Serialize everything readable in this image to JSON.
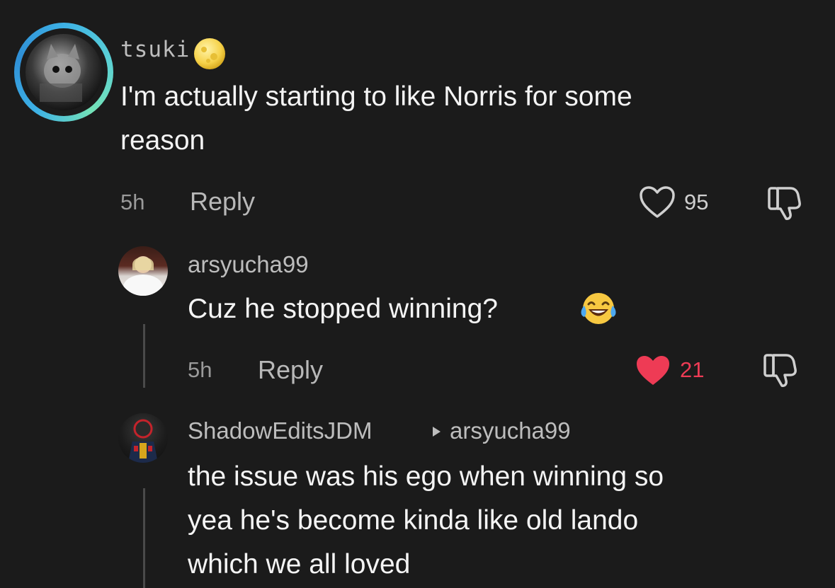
{
  "comments": [
    {
      "username": "tsuki",
      "text_line1": "I'm actually starting to like Norris for some",
      "text_line2": "reason",
      "time": "5h",
      "reply_label": "Reply",
      "likes": "95",
      "liked": false
    },
    {
      "username": "arsyucha99",
      "text": "Cuz he stopped winning?",
      "time": "5h",
      "reply_label": "Reply",
      "likes": "21",
      "liked": true
    },
    {
      "username": "ShadowEditsJDM",
      "reply_to": "arsyucha99",
      "text_line1": "the issue was his ego when winning so",
      "text_line2": "yea he's become kinda like old lando",
      "text_line3": "which we all loved"
    }
  ],
  "colors": {
    "background": "#1b1b1b",
    "like_active": "#ee3b55",
    "avatar_ring": "#3db1e6"
  },
  "icons": [
    "moon-emoji-icon",
    "heart-outline-icon",
    "heart-filled-icon",
    "dislike-icon",
    "laughing-emoji-icon",
    "play-arrow-icon"
  ]
}
